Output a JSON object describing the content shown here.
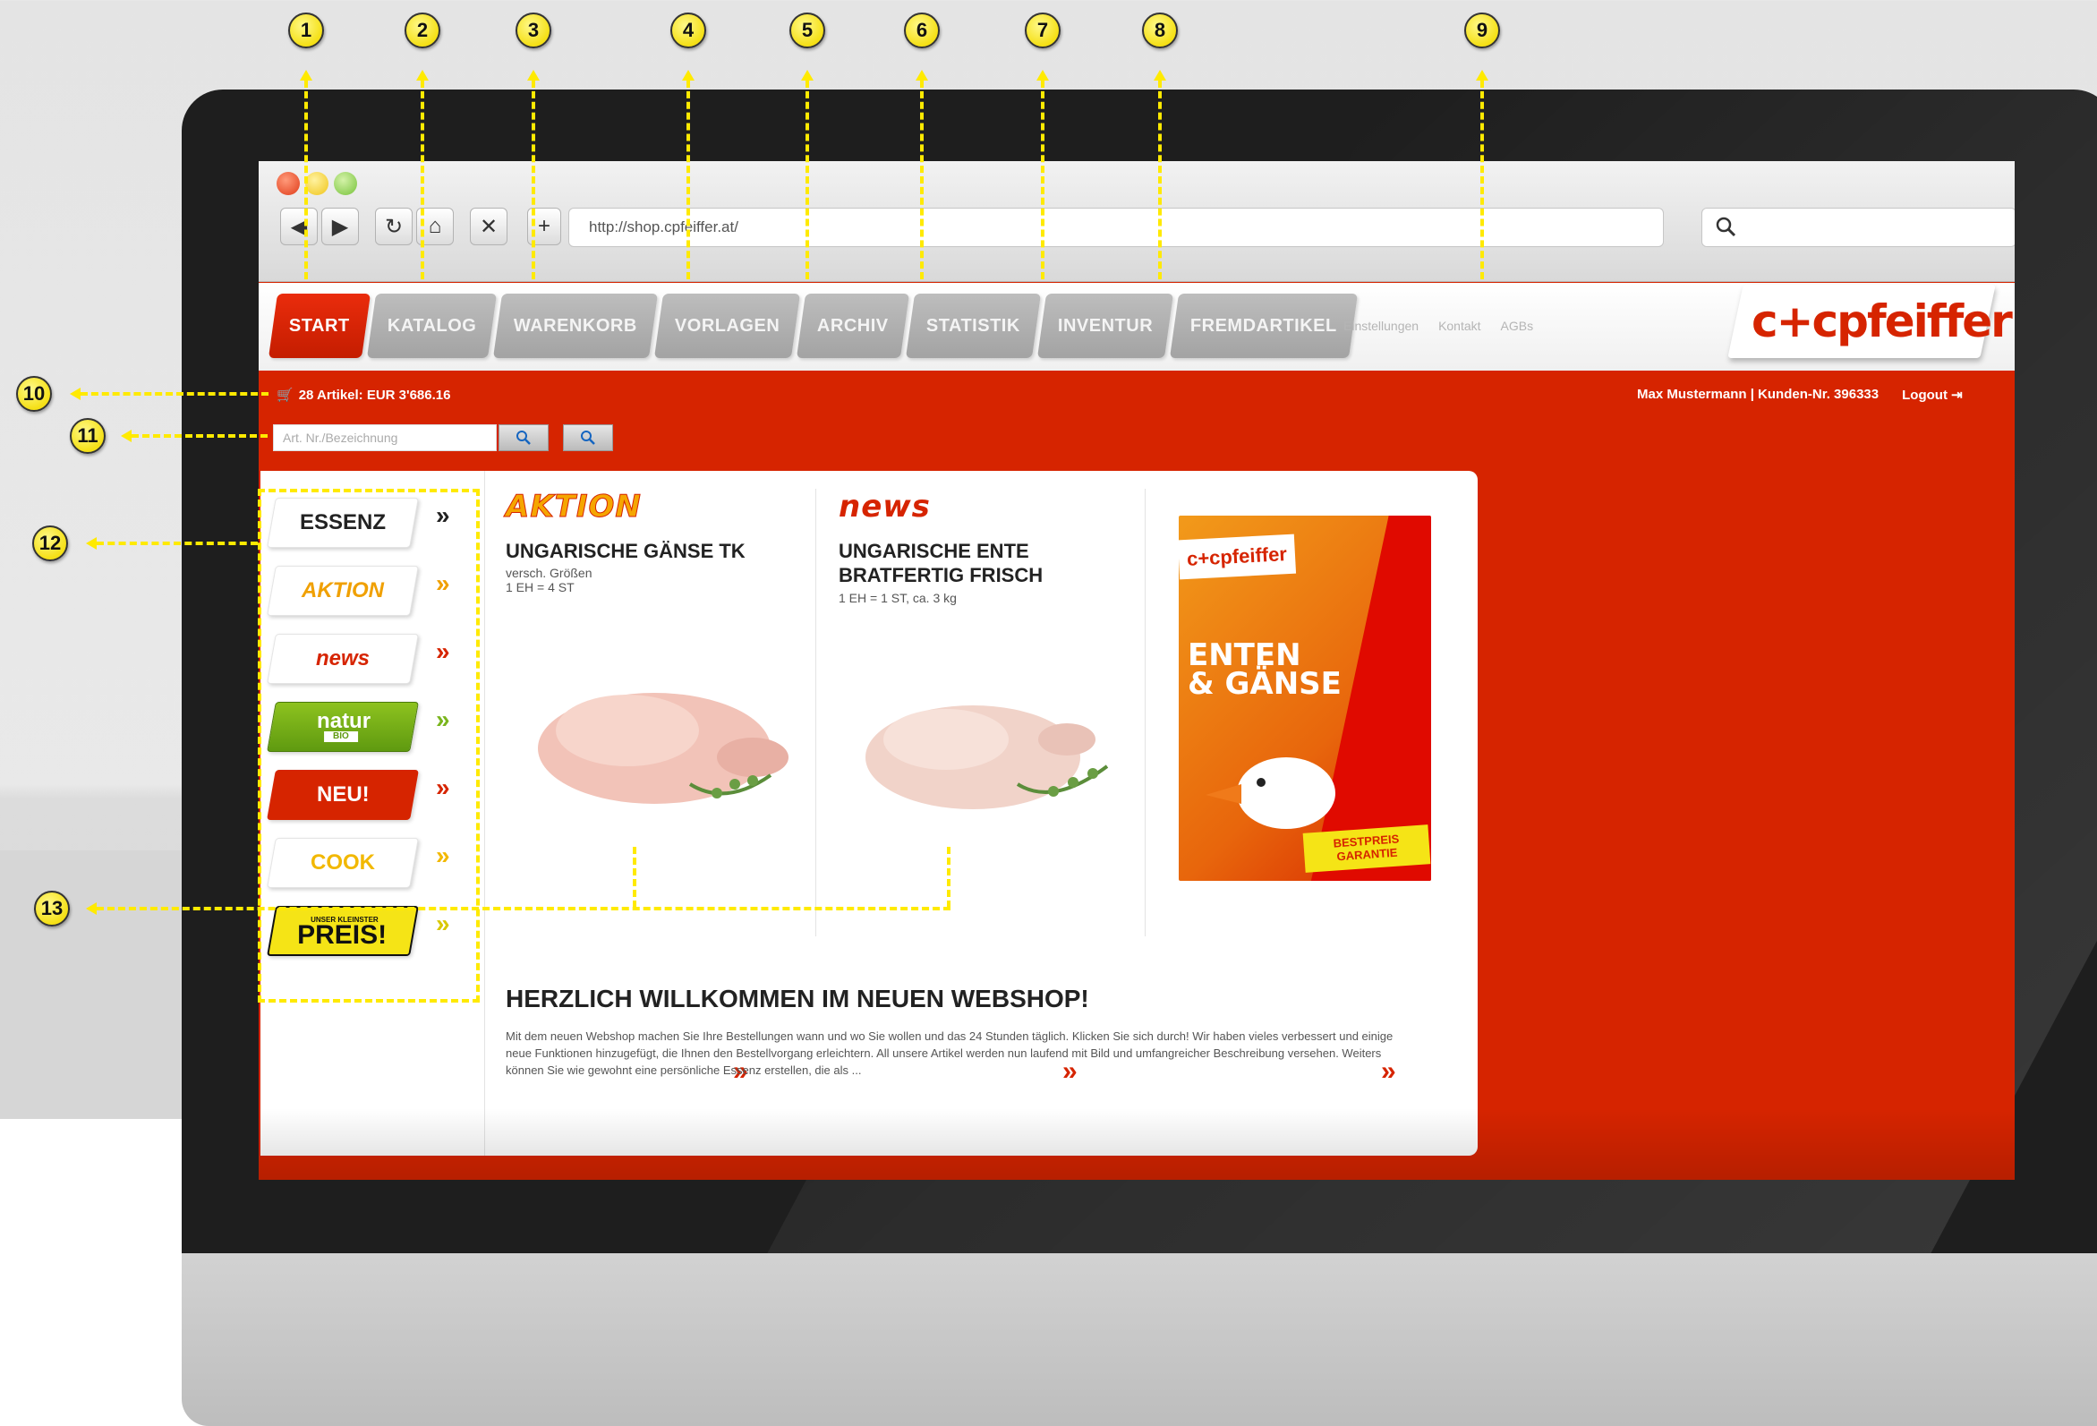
{
  "browser": {
    "url": "http://shop.cpfeiffer.at/",
    "search_placeholder": ""
  },
  "nav": {
    "tabs": [
      "START",
      "KATALOG",
      "WARENKORB",
      "VORLAGEN",
      "ARCHIV",
      "STATISTIK",
      "INVENTUR",
      "FREMDARTIKEL"
    ],
    "active": "START"
  },
  "toplinks": {
    "einstellungen": "Einstellungen",
    "kontakt": "Kontakt",
    "agbs": "AGBs"
  },
  "logo": "c+cpfeiffer",
  "cart": {
    "summary": "28 Artikel: EUR 3'686.16"
  },
  "user": {
    "info": "Max Mustermann | Kunden-Nr. 396333",
    "logout": "Logout"
  },
  "quicksearch": {
    "placeholder": "Art. Nr./Bezeichnung"
  },
  "sidebar": [
    "ESSENZ",
    "AKTION",
    "news",
    "natur",
    "NEU!",
    "COOK",
    "PREIS!"
  ],
  "sidebar_sub": {
    "natur": "BIO",
    "preis": "UNSER KLEINSTER"
  },
  "products": [
    {
      "brand": "AKTION",
      "title": "UNGARISCHE GÄNSE TK",
      "sub1": "versch. Größen",
      "sub2": "1 EH = 4 ST"
    },
    {
      "brand": "news",
      "title": "UNGARISCHE ENTE BRATFERTIG FRISCH",
      "sub1": "1 EH = 1 ST, ca. 3 kg",
      "sub2": ""
    }
  ],
  "promo": {
    "logo": "c+cpfeiffer",
    "headline1": "ENTEN",
    "headline2": "& GÄNSE",
    "badge": "BESTPREIS GARANTIE"
  },
  "welcome": {
    "title": "HERZLICH WILLKOMMEN IM NEUEN WEBSHOP!",
    "text": "Mit dem neuen Webshop machen Sie Ihre Bestellungen wann und wo Sie wollen und das 24 Stunden täglich. Klicken Sie sich durch! Wir haben vieles verbessert und einige neue Funktionen hinzugefügt, die Ihnen den Bestellvorgang erleichtern. All unsere Artikel werden nun laufend mit Bild und umfangreicher Beschreibung versehen. Weiters können Sie wie gewohnt eine persönliche Essenz erstellen, die als ..."
  },
  "callouts": [
    "1",
    "2",
    "3",
    "4",
    "5",
    "6",
    "7",
    "8",
    "9",
    "10",
    "11",
    "12",
    "13"
  ],
  "colors": {
    "brand_red": "#d62400",
    "callout_yellow": "#f5e016"
  },
  "icons": [
    "back-icon",
    "forward-icon",
    "reload-icon",
    "home-icon",
    "close-icon",
    "plus-icon",
    "search-icon",
    "cart-icon",
    "logout-icon",
    "chevron-right-icon"
  ]
}
